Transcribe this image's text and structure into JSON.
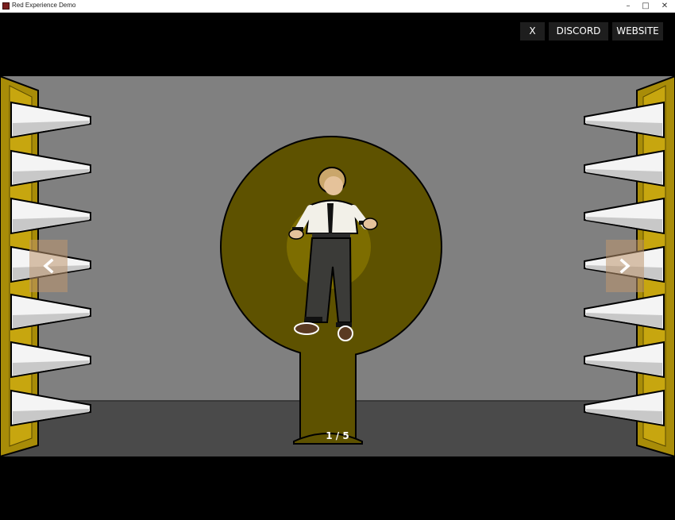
{
  "window": {
    "title": "Red Experience Demo",
    "minimize": "–",
    "maximize": "□",
    "close": "✕"
  },
  "toolbar": {
    "close_label": "X",
    "discord_label": "DISCORD",
    "website_label": "WEBSITE"
  },
  "gallery": {
    "page_indicator": "1 / 5",
    "current": 1,
    "total": 5
  },
  "colors": {
    "wall": "#808080",
    "floor": "#4a4a4a",
    "pedestal": "#5e5200",
    "spike_rail": "#c7a60f",
    "nav_button": "#be966e"
  },
  "icons": {
    "prev": "chevron-left-icon",
    "next": "chevron-right-icon"
  }
}
